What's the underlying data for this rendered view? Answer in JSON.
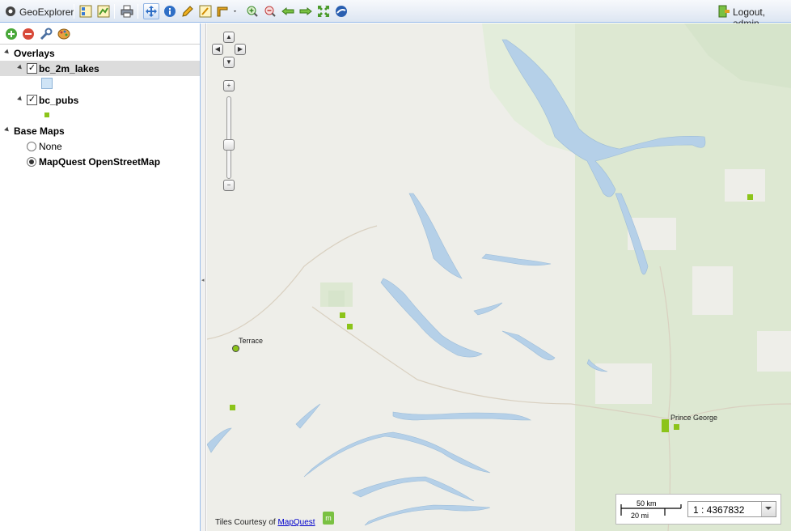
{
  "toolbar": {
    "app_title": "GeoExplorer",
    "logout_label": "Logout, admin",
    "buttons": [
      "layer-properties",
      "tree-toggle",
      "print",
      "pan",
      "info",
      "measure-edit",
      "query",
      "measure",
      "zoom-in",
      "zoom-out",
      "back",
      "forward",
      "zoom-extent",
      "google-earth"
    ]
  },
  "layers_panel": {
    "overlays_label": "Overlays",
    "layers": [
      {
        "name": "bc_2m_lakes",
        "checked": true,
        "legend_color": "#cfe4f6"
      },
      {
        "name": "bc_pubs",
        "checked": true,
        "legend_color": "#8cc41a"
      }
    ],
    "basemaps_label": "Base Maps",
    "basemaps": [
      {
        "name": "None",
        "selected": false
      },
      {
        "name": "MapQuest OpenStreetMap",
        "selected": true
      }
    ]
  },
  "map": {
    "cities": [
      "Terrace",
      "Prince George"
    ],
    "attribution_prefix": "Tiles Courtesy of",
    "attribution_link": "MapQuest",
    "scale_km": "50 km",
    "scale_mi": "20 mi",
    "scale_value": "1 : 4367832",
    "colors": {
      "water": "#b5d0e8",
      "land": "#eeeee9",
      "forest": "#dde8d2",
      "pubs": "#8cc41a"
    }
  }
}
